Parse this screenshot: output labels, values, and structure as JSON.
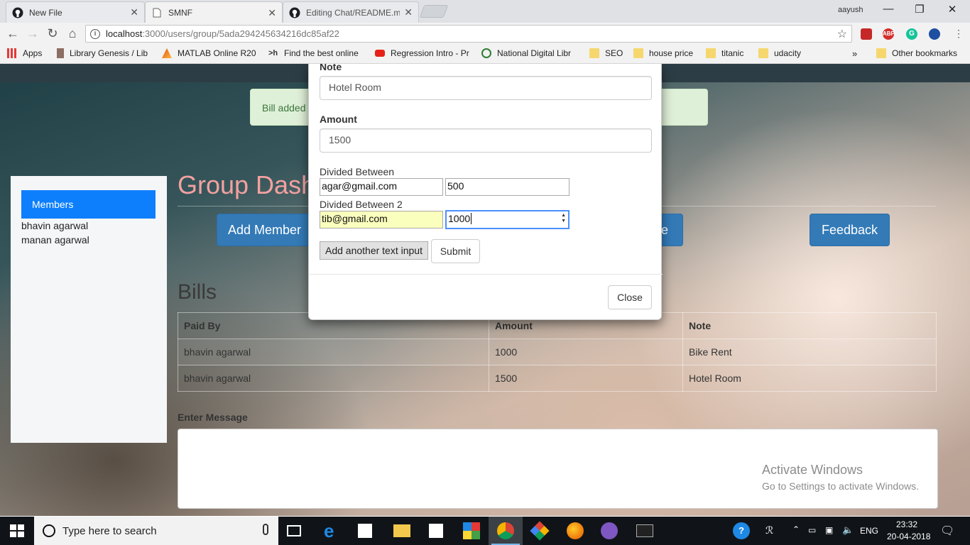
{
  "browser": {
    "tabs": [
      {
        "title": "New File",
        "icon": "github-icon"
      },
      {
        "title": "SMNF",
        "icon": "page-icon"
      },
      {
        "title": "Editing Chat/README.md",
        "icon": "github-icon"
      }
    ],
    "user": "aayush",
    "url_host": "localhost",
    "url_path": ":3000/users/group/5ada294245634216dc85af22",
    "bookmarks": [
      {
        "label": "Apps",
        "icon": "apps-icon"
      },
      {
        "label": "Library Genesis / Lib",
        "icon": "book-icon"
      },
      {
        "label": "MATLAB Online R20",
        "icon": "matlab-icon"
      },
      {
        "label": "Find the best online",
        "icon": "hackerrank-icon"
      },
      {
        "label": "Regression Intro - Pr",
        "icon": "youtube-icon"
      },
      {
        "label": "National Digital Libr",
        "icon": "ndl-icon"
      },
      {
        "label": "SEO",
        "icon": "folder-icon"
      },
      {
        "label": "house price",
        "icon": "folder-icon"
      },
      {
        "label": "titanic",
        "icon": "folder-icon"
      },
      {
        "label": "udacity",
        "icon": "folder-icon"
      },
      {
        "label": "Other bookmarks",
        "icon": "folder-icon"
      }
    ]
  },
  "alert": {
    "text": "Bill added"
  },
  "sidebar": {
    "heading": "Members",
    "members": [
      "bhavin agarwal",
      "manan agarwal"
    ]
  },
  "dashboard": {
    "title": "Group Dash",
    "add_member_label": "Add Member",
    "partial_button_label": "le",
    "feedback_label": "Feedback"
  },
  "bills": {
    "title": "Bills",
    "columns": [
      "Paid By",
      "Amount",
      "Note"
    ],
    "rows": [
      [
        "bhavin agarwal",
        "1000",
        "Bike Rent"
      ],
      [
        "bhavin agarwal",
        "1500",
        "Hotel Room"
      ]
    ]
  },
  "message": {
    "label": "Enter Message"
  },
  "watermark": {
    "title": "Activate Windows",
    "subtitle": "Go to Settings to activate Windows."
  },
  "modal": {
    "note_label": "Note",
    "note_value": "Hotel Room",
    "amount_label": "Amount",
    "amount_value": "1500",
    "divided_label_1": "Divided Between",
    "email_1": "agar@gmail.com",
    "share_1": "500",
    "divided_label_2": "Divided Between 2",
    "email_2": "tib@gmail.com",
    "share_2": "1000",
    "add_input_label": "Add another text input",
    "submit_label": "Submit",
    "close_label": "Close"
  },
  "taskbar": {
    "search_placeholder": "Type here to search",
    "language": "ENG",
    "time": "23:32",
    "date": "20-04-2018"
  },
  "colors": {
    "primary": "#337ab7",
    "members_header": "#0d7ffc",
    "title_pink": "#f3a1a0",
    "alert_bg": "#dff0d8",
    "autofill": "#faffbd"
  }
}
